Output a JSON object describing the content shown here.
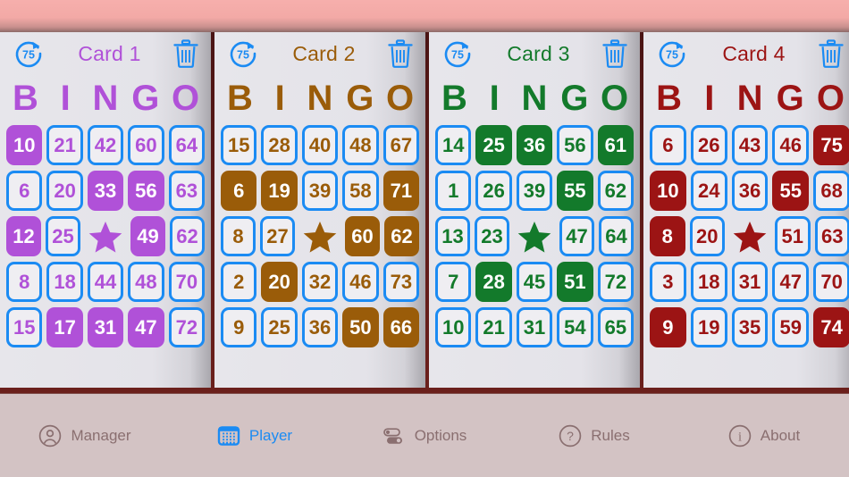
{
  "app": {
    "active_tab": "Player"
  },
  "cards": [
    {
      "title": "Card 1",
      "color": "#b051d8",
      "refresh_label": "75",
      "refresh_icon": "refresh-75-icon",
      "delete_icon": "trash-icon",
      "bingo_letters": [
        "B",
        "I",
        "N",
        "G",
        "O"
      ],
      "rows": [
        [
          {
            "n": "10",
            "m": true
          },
          {
            "n": "21",
            "m": false
          },
          {
            "n": "42",
            "m": false
          },
          {
            "n": "60",
            "m": false
          },
          {
            "n": "64",
            "m": false
          }
        ],
        [
          {
            "n": "6",
            "m": false
          },
          {
            "n": "20",
            "m": false
          },
          {
            "n": "33",
            "m": true
          },
          {
            "n": "56",
            "m": true
          },
          {
            "n": "63",
            "m": false
          }
        ],
        [
          {
            "n": "12",
            "m": true
          },
          {
            "n": "25",
            "m": false
          },
          {
            "n": "FREE",
            "m": false,
            "free": true
          },
          {
            "n": "49",
            "m": true
          },
          {
            "n": "62",
            "m": false
          }
        ],
        [
          {
            "n": "8",
            "m": false
          },
          {
            "n": "18",
            "m": false
          },
          {
            "n": "44",
            "m": false
          },
          {
            "n": "48",
            "m": false
          },
          {
            "n": "70",
            "m": false
          }
        ],
        [
          {
            "n": "15",
            "m": false
          },
          {
            "n": "17",
            "m": true
          },
          {
            "n": "31",
            "m": true
          },
          {
            "n": "47",
            "m": true
          },
          {
            "n": "72",
            "m": false
          }
        ]
      ]
    },
    {
      "title": "Card 2",
      "color": "#9a5c09",
      "refresh_label": "75",
      "refresh_icon": "refresh-75-icon",
      "delete_icon": "trash-icon",
      "bingo_letters": [
        "B",
        "I",
        "N",
        "G",
        "O"
      ],
      "rows": [
        [
          {
            "n": "15",
            "m": false
          },
          {
            "n": "28",
            "m": false
          },
          {
            "n": "40",
            "m": false
          },
          {
            "n": "48",
            "m": false
          },
          {
            "n": "67",
            "m": false
          }
        ],
        [
          {
            "n": "6",
            "m": true
          },
          {
            "n": "19",
            "m": true
          },
          {
            "n": "39",
            "m": false
          },
          {
            "n": "58",
            "m": false
          },
          {
            "n": "71",
            "m": true
          }
        ],
        [
          {
            "n": "8",
            "m": false
          },
          {
            "n": "27",
            "m": false
          },
          {
            "n": "FREE",
            "m": false,
            "free": true
          },
          {
            "n": "60",
            "m": true
          },
          {
            "n": "62",
            "m": true
          }
        ],
        [
          {
            "n": "2",
            "m": false
          },
          {
            "n": "20",
            "m": true
          },
          {
            "n": "32",
            "m": false
          },
          {
            "n": "46",
            "m": false
          },
          {
            "n": "73",
            "m": false
          }
        ],
        [
          {
            "n": "9",
            "m": false
          },
          {
            "n": "25",
            "m": false
          },
          {
            "n": "36",
            "m": false
          },
          {
            "n": "50",
            "m": true
          },
          {
            "n": "66",
            "m": true
          }
        ]
      ]
    },
    {
      "title": "Card 3",
      "color": "#137a2b",
      "refresh_label": "75",
      "refresh_icon": "refresh-75-icon",
      "delete_icon": "trash-icon",
      "bingo_letters": [
        "B",
        "I",
        "N",
        "G",
        "O"
      ],
      "rows": [
        [
          {
            "n": "14",
            "m": false
          },
          {
            "n": "25",
            "m": true
          },
          {
            "n": "36",
            "m": true
          },
          {
            "n": "56",
            "m": false
          },
          {
            "n": "61",
            "m": true
          }
        ],
        [
          {
            "n": "1",
            "m": false
          },
          {
            "n": "26",
            "m": false
          },
          {
            "n": "39",
            "m": false
          },
          {
            "n": "55",
            "m": true
          },
          {
            "n": "62",
            "m": false
          }
        ],
        [
          {
            "n": "13",
            "m": false
          },
          {
            "n": "23",
            "m": false
          },
          {
            "n": "FREE",
            "m": false,
            "free": true
          },
          {
            "n": "47",
            "m": false
          },
          {
            "n": "64",
            "m": false
          }
        ],
        [
          {
            "n": "7",
            "m": false
          },
          {
            "n": "28",
            "m": true
          },
          {
            "n": "45",
            "m": false
          },
          {
            "n": "51",
            "m": true
          },
          {
            "n": "72",
            "m": false
          }
        ],
        [
          {
            "n": "10",
            "m": false
          },
          {
            "n": "21",
            "m": false
          },
          {
            "n": "31",
            "m": false
          },
          {
            "n": "54",
            "m": false
          },
          {
            "n": "65",
            "m": false
          }
        ]
      ]
    },
    {
      "title": "Card 4",
      "color": "#9c1414",
      "refresh_label": "75",
      "refresh_icon": "refresh-75-icon",
      "delete_icon": "trash-icon",
      "bingo_letters": [
        "B",
        "I",
        "N",
        "G",
        "O"
      ],
      "rows": [
        [
          {
            "n": "6",
            "m": false
          },
          {
            "n": "26",
            "m": false
          },
          {
            "n": "43",
            "m": false
          },
          {
            "n": "46",
            "m": false
          },
          {
            "n": "75",
            "m": true
          }
        ],
        [
          {
            "n": "10",
            "m": true
          },
          {
            "n": "24",
            "m": false
          },
          {
            "n": "36",
            "m": false
          },
          {
            "n": "55",
            "m": true
          },
          {
            "n": "68",
            "m": false
          }
        ],
        [
          {
            "n": "8",
            "m": true
          },
          {
            "n": "20",
            "m": false
          },
          {
            "n": "FREE",
            "m": false,
            "free": true
          },
          {
            "n": "51",
            "m": false
          },
          {
            "n": "63",
            "m": false
          }
        ],
        [
          {
            "n": "3",
            "m": false
          },
          {
            "n": "18",
            "m": false
          },
          {
            "n": "31",
            "m": false
          },
          {
            "n": "47",
            "m": false
          },
          {
            "n": "70",
            "m": false
          }
        ],
        [
          {
            "n": "9",
            "m": true
          },
          {
            "n": "19",
            "m": false
          },
          {
            "n": "35",
            "m": false
          },
          {
            "n": "59",
            "m": false
          },
          {
            "n": "74",
            "m": true
          }
        ]
      ]
    }
  ],
  "tabbar": {
    "items": [
      {
        "label": "Manager",
        "icon": "person-circle-icon",
        "active": false
      },
      {
        "label": "Player",
        "icon": "grid-keypad-icon",
        "active": true
      },
      {
        "label": "Options",
        "icon": "toggles-icon",
        "active": false
      },
      {
        "label": "Rules",
        "icon": "question-circle-icon",
        "active": false
      },
      {
        "label": "About",
        "icon": "info-circle-icon",
        "active": false
      }
    ]
  },
  "colors": {
    "accent_blue": "#1b8bf3",
    "tabbar_bg": "#d3c3c4",
    "cards_bg": "#5d1a18",
    "topbar_pink": "#f5aead",
    "card_bg": "#e4e3e9"
  }
}
